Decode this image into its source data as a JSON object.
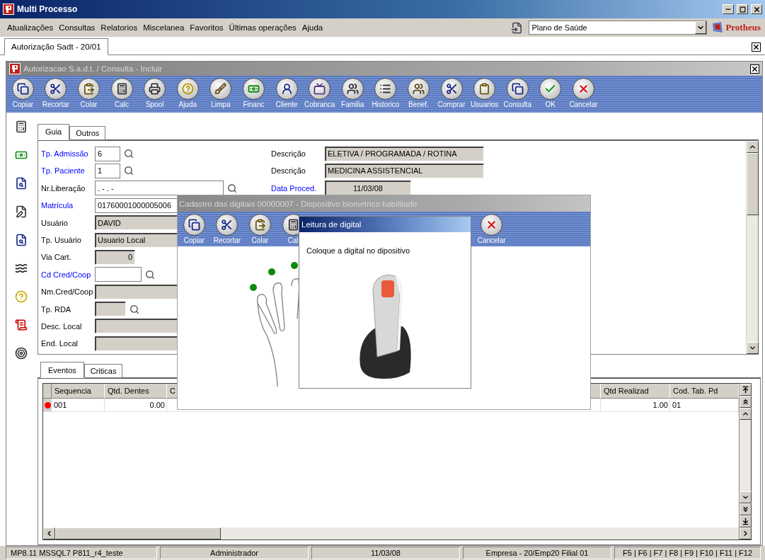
{
  "window": {
    "title": "Multi Processo"
  },
  "menu": [
    "Atualizações",
    "Consultas",
    "Relatorios",
    "Miscelanea",
    "Favoritos",
    "Últimas operações",
    "Ajuda"
  ],
  "module_select": {
    "value": "Plano de Saúde"
  },
  "brand": {
    "name": "Protheus"
  },
  "document_tab": {
    "label": "Autorização Sadt - 20/01",
    "selected": true
  },
  "form_window": {
    "title": "Autorizacao S.a.d.t. / Consulta - Incluir",
    "toolbar": [
      {
        "label": "Copiar",
        "kind": "copy"
      },
      {
        "label": "Recortar",
        "kind": "cut"
      },
      {
        "label": "Colar",
        "kind": "paste"
      },
      {
        "label": "Calc",
        "kind": "calculator"
      },
      {
        "label": "Spool",
        "kind": "printer"
      },
      {
        "label": "Ajuda",
        "kind": "help"
      },
      {
        "label": "Limpa",
        "kind": "broom"
      },
      {
        "label": "Financ",
        "kind": "money"
      },
      {
        "label": "Cliente",
        "kind": "client"
      },
      {
        "label": "Cobranca",
        "kind": "billing"
      },
      {
        "label": "Familia",
        "kind": "family"
      },
      {
        "label": "Historico",
        "kind": "history"
      },
      {
        "label": "Benef.",
        "kind": "people"
      },
      {
        "label": "Comprar",
        "kind": "cut"
      },
      {
        "label": "Usuarios",
        "kind": "clipboard"
      },
      {
        "label": "Consulta",
        "kind": "copy"
      },
      {
        "label": "OK",
        "kind": "ok"
      },
      {
        "label": "Cancelar",
        "kind": "cancel"
      }
    ]
  },
  "form_tabs": [
    {
      "label": "Guia",
      "selected": true
    },
    {
      "label": "Outros",
      "selected": false
    }
  ],
  "fields_left": [
    {
      "label": "Tp. Admissão",
      "required": true,
      "value": "6",
      "readonly": false,
      "lookup": true
    },
    {
      "label": "Tp. Paciente",
      "required": true,
      "value": "1",
      "readonly": false,
      "lookup": true
    },
    {
      "label": "Nr.Liberação",
      "required": false,
      "value": ". -  . -",
      "readonly": false,
      "lookup": true
    },
    {
      "label": "Matrícula",
      "required": true,
      "value": "01760001000005006",
      "readonly": false,
      "lookup": false
    },
    {
      "label": "Usuário",
      "required": false,
      "value": "DAVID",
      "readonly": true,
      "lookup": false
    },
    {
      "label": "Tp. Usuário",
      "required": false,
      "value": "Usuario Local",
      "readonly": true,
      "lookup": false
    },
    {
      "label": "Via Cart.",
      "required": false,
      "value": "0",
      "readonly": true,
      "lookup": false
    },
    {
      "label": "Cd Cred/Coop",
      "required": true,
      "readonly": false,
      "lookup": true
    },
    {
      "label": "Nm.Cred/Coop",
      "required": false,
      "readonly": true,
      "lookup": false
    },
    {
      "label": "Tp. RDA",
      "required": false,
      "readonly": true,
      "lookup": true
    },
    {
      "label": "Desc. Local",
      "required": false,
      "readonly": true,
      "lookup": false
    },
    {
      "label": "End. Local",
      "required": false,
      "readonly": true,
      "lookup": false
    }
  ],
  "fields_right": [
    {
      "label": "Descrição",
      "required": false,
      "value": "ELETIVA / PROGRAMADA / ROTINA"
    },
    {
      "label": "Descrição",
      "required": false,
      "value": "MEDICINA ASSISTENCIAL"
    },
    {
      "label": "Data Proced.",
      "required": true,
      "value": "11/03/08"
    }
  ],
  "bottom_tabs": [
    {
      "label": "Eventos",
      "selected": true
    },
    {
      "label": "Criticas",
      "selected": false
    }
  ],
  "grid": {
    "columns": [
      {
        "label": "Sequencia"
      },
      {
        "label": "Qtd. Dentes"
      },
      {
        "label": "C"
      },
      {
        "label": "Qtd Realizad"
      },
      {
        "label": "Cod. Tab. Pd"
      }
    ],
    "rows": [
      {
        "color": "#ff0000",
        "cells": [
          "001",
          "0.00",
          "",
          "1.00",
          "01"
        ]
      }
    ]
  },
  "status_bar": [
    "MP8.11   MSSQL7 P811_r4_teste",
    "Administrador",
    "11/03/08",
    "Empresa - 20/Emp20 Filial 01",
    "F5 | F6 | F7 | F8 | F9 | F10 | F11 | F12"
  ],
  "biometric_window": {
    "title": "Cadastro das digitais 00000007 - Dispositivo biometrico habilitado",
    "toolbar": [
      {
        "label": "Copiar",
        "kind": "copy"
      },
      {
        "label": "Recortar",
        "kind": "cut"
      },
      {
        "label": "Colar",
        "kind": "paste"
      },
      {
        "label": "Cal",
        "kind": "calculator"
      },
      {
        "label": "Cancelar",
        "kind": "cancel"
      }
    ]
  },
  "reader_dialog": {
    "title": "Leitura de digital",
    "message": "Coloque a digital no dipositivo"
  }
}
